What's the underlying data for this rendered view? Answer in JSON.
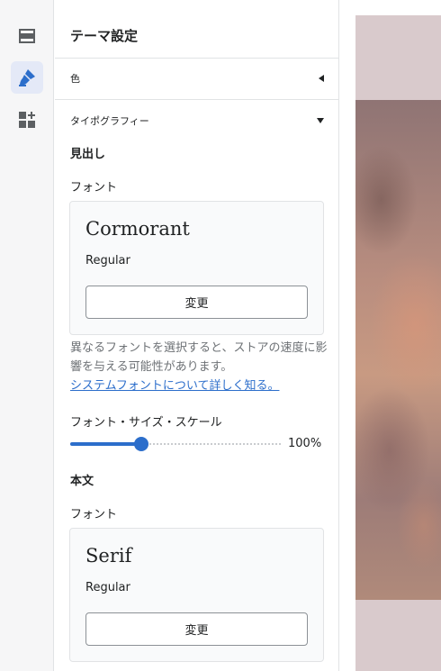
{
  "sidebar": {
    "icons": [
      {
        "name": "sections-icon"
      },
      {
        "name": "theme-settings-icon",
        "active": true
      },
      {
        "name": "apps-icon"
      }
    ]
  },
  "panel": {
    "title": "テーマ設定",
    "color_section": "色",
    "typography_section": "タイポグラフィー",
    "headings": {
      "title": "見出し",
      "font_label": "フォント",
      "font_name": "Cormorant",
      "font_style": "Regular",
      "change_label": "変更",
      "help_text": "異なるフォントを選択すると、ストアの速度に影響を与える可能性があります。",
      "help_link": "システムフォントについて詳しく知る。",
      "scale_label": "フォント・サイズ・スケール",
      "scale_value": "100%",
      "scale_level": 0.35
    },
    "body": {
      "title": "本文",
      "font_label": "フォント",
      "font_name": "Serif",
      "font_style": "Regular",
      "change_label": "変更"
    }
  },
  "colors": {
    "accent": "#2c6ecb",
    "active_bg": "#e4e9f7"
  }
}
